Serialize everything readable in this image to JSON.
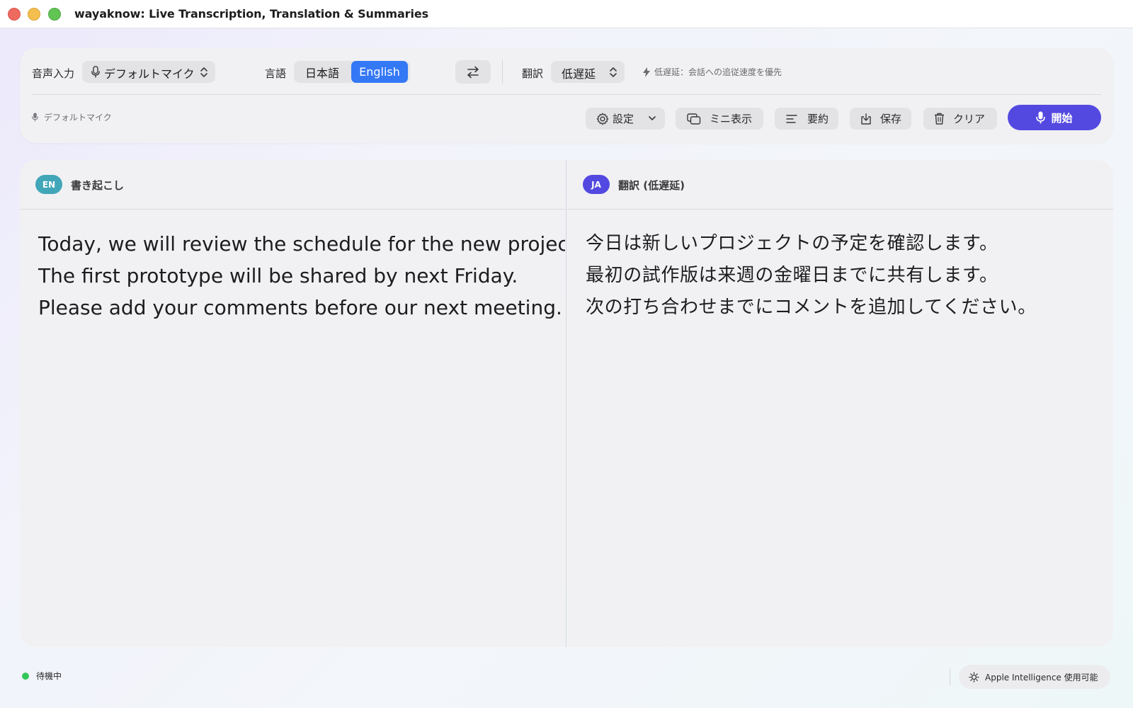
{
  "window": {
    "title": "wayaknow: Live Transcription, Translation & Summaries"
  },
  "toolbar": {
    "input_label": "音声入力",
    "mic_select_value": "デフォルトマイク",
    "language_label": "言語",
    "lang_japanese": "日本語",
    "lang_english": "English",
    "translation_label": "翻訳",
    "translation_mode_value": "低遅延",
    "hint_text": "低遅延：会話への追従速度を優先",
    "mic_status": "デフォルトマイク",
    "settings_label": "設定",
    "mini_label": "ミニ表示",
    "summary_label": "要約",
    "save_label": "保存",
    "clear_label": "クリア",
    "start_label": "開始",
    "accent_color": "#5349e0",
    "selected_lang_color": "#3478f6"
  },
  "panels": {
    "left": {
      "badge": "EN",
      "title": "書き起こし",
      "lines": [
        "Today, we will review the schedule for the new project.",
        "The first prototype will be shared by next Friday.",
        "Please add your comments before our next meeting."
      ]
    },
    "right": {
      "badge": "JA",
      "title": "翻訳 (低遅延)",
      "lines": [
        "今日は新しいプロジェクトの予定を確認します。",
        "最初の試作版は来週の金曜日までに共有します。",
        "次の打ち合わせまでにコメントを追加してください。"
      ]
    }
  },
  "status": {
    "text": "待機中",
    "ai_status": "Apple Intelligence 使用可能"
  }
}
